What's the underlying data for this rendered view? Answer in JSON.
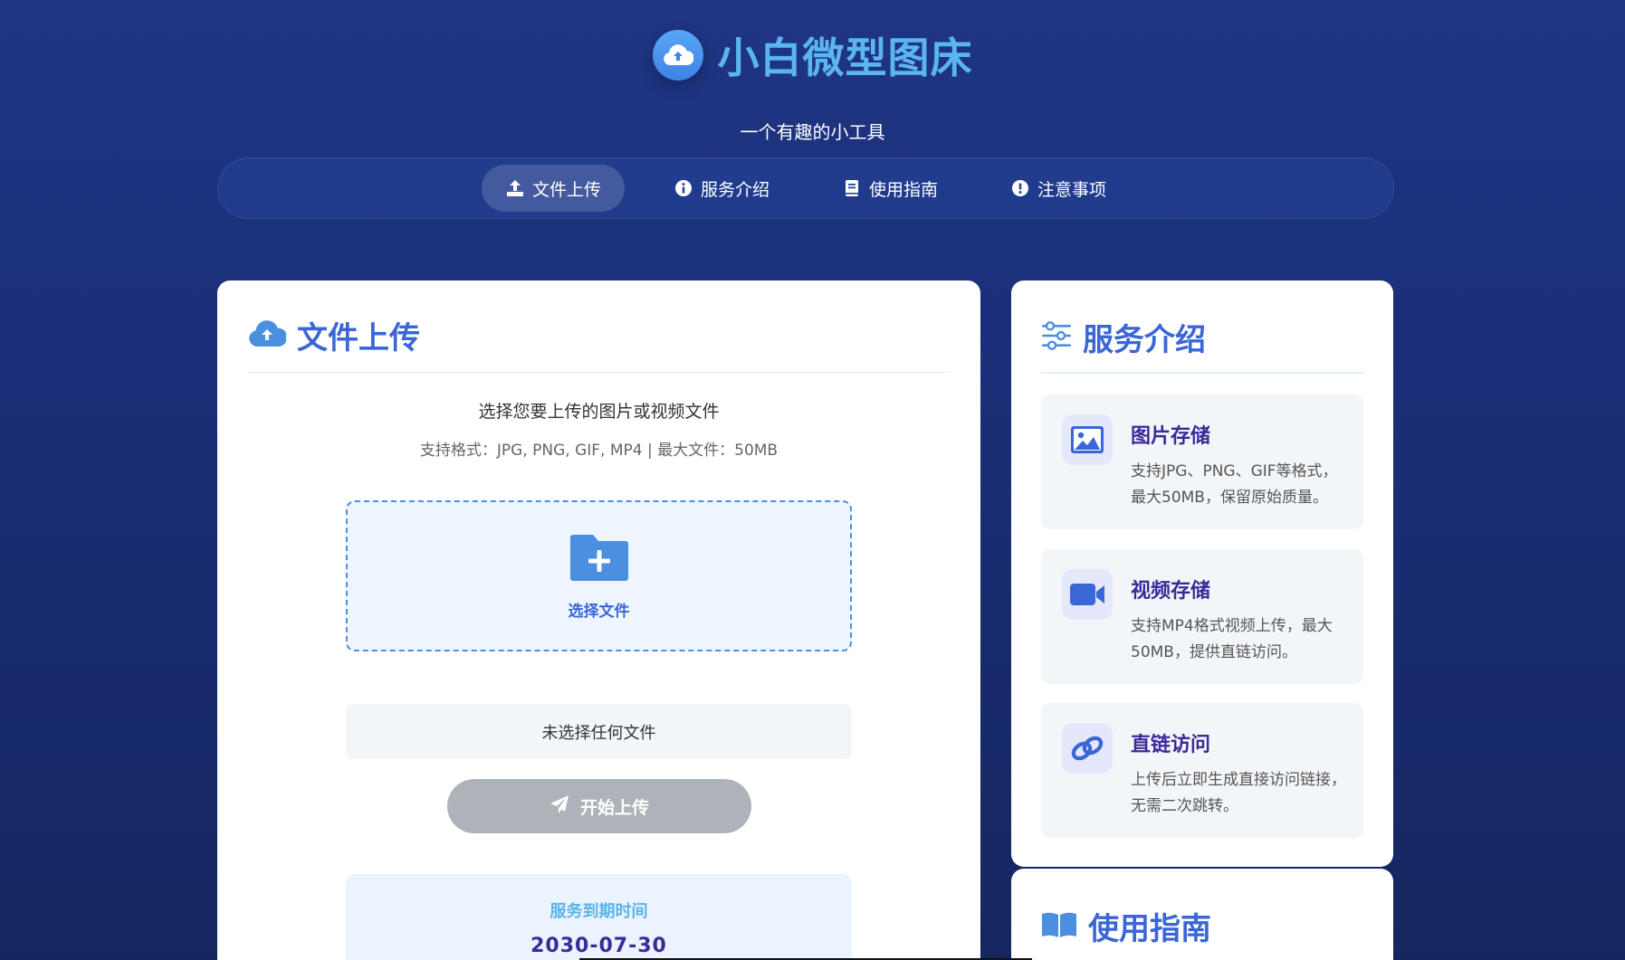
{
  "header": {
    "logo_icon": "cloud-upload-icon",
    "title": "小白微型图床",
    "subtitle": "一个有趣的小工具"
  },
  "nav": {
    "items": [
      {
        "label": "文件上传",
        "icon": "upload-icon",
        "active": true
      },
      {
        "label": "服务介绍",
        "icon": "info-icon",
        "active": false
      },
      {
        "label": "使用指南",
        "icon": "book-icon",
        "active": false
      },
      {
        "label": "注意事项",
        "icon": "exclamation-icon",
        "active": false
      }
    ]
  },
  "upload": {
    "title": "文件上传",
    "hint": "选择您要上传的图片或视频文件",
    "formats": "支持格式：JPG, PNG, GIF, MP4 | 最大文件：50MB",
    "dropzone_label": "选择文件",
    "file_status": "未选择任何文件",
    "button_label": "开始上传",
    "expire_label": "服务到期时间",
    "expire_date": "2030-07-30"
  },
  "services": {
    "title": "服务介绍",
    "features": [
      {
        "title": "图片存储",
        "desc": "支持JPG、PNG、GIF等格式，最大50MB，保留原始质量。",
        "icon": "image-icon"
      },
      {
        "title": "视频存储",
        "desc": "支持MP4格式视频上传，最大50MB，提供直链访问。",
        "icon": "video-icon"
      },
      {
        "title": "直链访问",
        "desc": "上传后立即生成直接访问链接，无需二次跳转。",
        "icon": "link-icon"
      }
    ]
  },
  "guide": {
    "title": "使用指南"
  },
  "colors": {
    "accent_blue": "#3a66d6",
    "title_cyan": "#5bb5f0",
    "feature_title": "#3a2a9a",
    "button_disabled": "#aeb3b9",
    "background_top": "#1f3583",
    "background_bottom": "#15265f"
  }
}
